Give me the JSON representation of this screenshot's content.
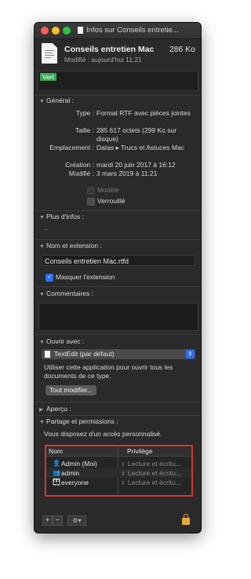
{
  "window": {
    "title": "Infos sur Conseils entretie..."
  },
  "header": {
    "filename": "Conseils entretien Mac",
    "size": "286 Ko",
    "modified": "Modifié : aujourd'hui 11:21"
  },
  "tags": {
    "items": [
      "Vert"
    ],
    "color": "#34a853"
  },
  "general": {
    "title": "Général :",
    "rows": [
      {
        "key": "Type :",
        "value": "Format RTF avec pièces jointes"
      },
      {
        "key": "Taille :",
        "value": "285 617 octets (299 Ko sur disque)"
      },
      {
        "key": "Emplacement :",
        "value": "Datas ▸ Trucs et Astuces Mac"
      },
      {
        "key": "Création :",
        "value": "mardi 20 juin 2017 à 16:12"
      },
      {
        "key": "Modifié :",
        "value": "3 mars 2019 à 11:21"
      }
    ],
    "modele_label": "Modèle",
    "verrouille_label": "Verrouillé"
  },
  "plus_infos": {
    "title": "Plus d'infos :",
    "value": "--"
  },
  "name_ext": {
    "title": "Nom et extension :",
    "filename": "Conseils entretien Mac.rtfd",
    "hide_ext_label": "Masquer l'extension",
    "hide_ext_checked": true
  },
  "comments": {
    "title": "Commentaires :"
  },
  "open_with": {
    "title": "Ouvrir avec :",
    "app": "TextEdit (par défaut)",
    "description": "Utiliser cette application pour ouvrir tous les documents de ce type.",
    "change_all_label": "Tout modifier..."
  },
  "preview": {
    "title": "Aperçu :"
  },
  "sharing": {
    "title": "Partage et permissions :",
    "info": "Vous disposez d'un accès personnalisé.",
    "col_name": "Nom",
    "col_priv": "Privilège",
    "rows": [
      {
        "name": "Admin (Moi)",
        "priv": "Lecture et écritu..."
      },
      {
        "name": "admin",
        "priv": "Lecture et écritu..."
      },
      {
        "name": "everyone",
        "priv": "Lecture et écritu..."
      }
    ],
    "highlight_color": "#d9352c"
  },
  "footer": {
    "add": "+",
    "remove": "−",
    "action": "⚙▾"
  }
}
